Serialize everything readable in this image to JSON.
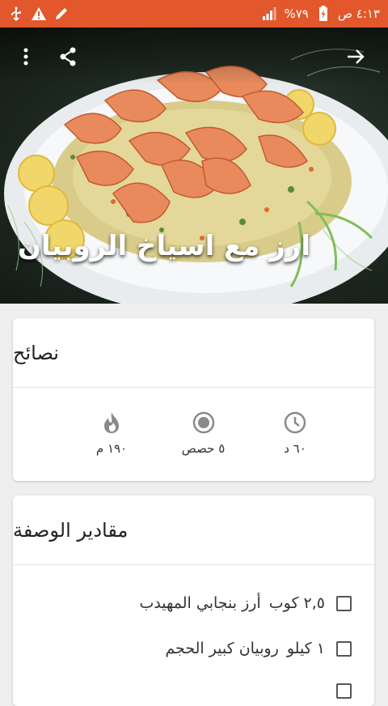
{
  "status_bar": {
    "time": "٤:١٣ ص",
    "battery": "%٧٩",
    "background_color": "#e2572b",
    "icons_right": [
      "signal-icon",
      "battery-icon"
    ],
    "icons_left": [
      "usb-icon",
      "warning-icon",
      "edit-icon"
    ]
  },
  "hero": {
    "title": "ارز مع اسياخ الروبيان",
    "icons": [
      "more-vert-icon",
      "share-icon",
      "arrow-forward-icon"
    ]
  },
  "tips": {
    "title": "نصائح",
    "items": [
      {
        "icon": "fire-icon",
        "label": "١٩٠ م"
      },
      {
        "icon": "servings-icon",
        "label": "٥ حصص"
      },
      {
        "icon": "clock-icon",
        "label": "٦٠ د"
      }
    ]
  },
  "ingredients": {
    "title": "مقادير الوصفة",
    "items": [
      {
        "qty": "٢,٥ كوب",
        "name": "أرز بنجابي المهيدب"
      },
      {
        "qty": "١ كيلو",
        "name": "روبيان كبير الحجم"
      }
    ]
  },
  "colors": {
    "accent": "#e2572b",
    "icon_gray": "#8a8a8a",
    "card_bg": "#ffffff",
    "page_bg": "#efefef"
  }
}
